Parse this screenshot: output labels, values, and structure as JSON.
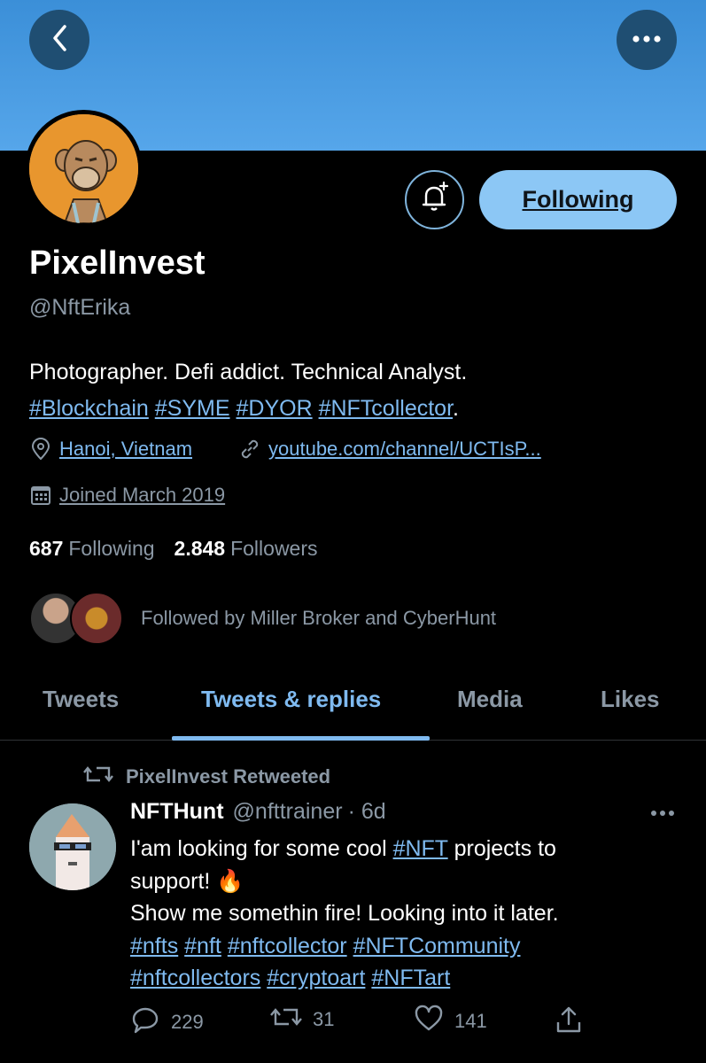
{
  "profile": {
    "name": "PixelInvest",
    "handle": "@NftErika",
    "follow_state": "Following",
    "bio_text": "Photographer. Defi addict. Technical Analyst.",
    "bio_hashtags": [
      "#Blockchain",
      "#SYME",
      "#DYOR",
      "#NFTcollector"
    ],
    "bio_end": ".",
    "location": "Hanoi, Vietnam",
    "website": "youtube.com/channel/UCTIsP...",
    "joined": "Joined March 2019",
    "following_count": "687",
    "following_label": "Following",
    "followers_count": "2.848",
    "followers_label": "Followers",
    "followed_by": "Followed by Miller Broker and CyberHunt"
  },
  "tabs": [
    {
      "label": "Tweets"
    },
    {
      "label": "Tweets & replies"
    },
    {
      "label": "Media"
    },
    {
      "label": "Likes"
    }
  ],
  "active_tab": "Tweets & replies",
  "tweet": {
    "retweet_label": "PixelInvest Retweeted",
    "author": "NFTHunt",
    "author_handle": "@nfttrainer",
    "time": "· 6d",
    "line1_pre": "I'am looking for some cool ",
    "line1_tag": "#NFT",
    "line1_post": " projects to",
    "line2": "support! ",
    "emoji": "🔥",
    "line3": "Show me somethin fire! Looking into it later.",
    "hashtags_row1": [
      "#nfts",
      "#nft",
      "#nftcollector",
      "#NFTCommunity"
    ],
    "hashtags_row2": [
      "#nftcollectors",
      "#cryptoart",
      "#NFTart"
    ],
    "replies": "229",
    "retweets": "31",
    "likes": "141"
  },
  "colors": {
    "accent": "#7fbaf0",
    "follow_button": "#8cc7f5",
    "banner": "#56a6ea",
    "muted": "#8b98a5"
  }
}
